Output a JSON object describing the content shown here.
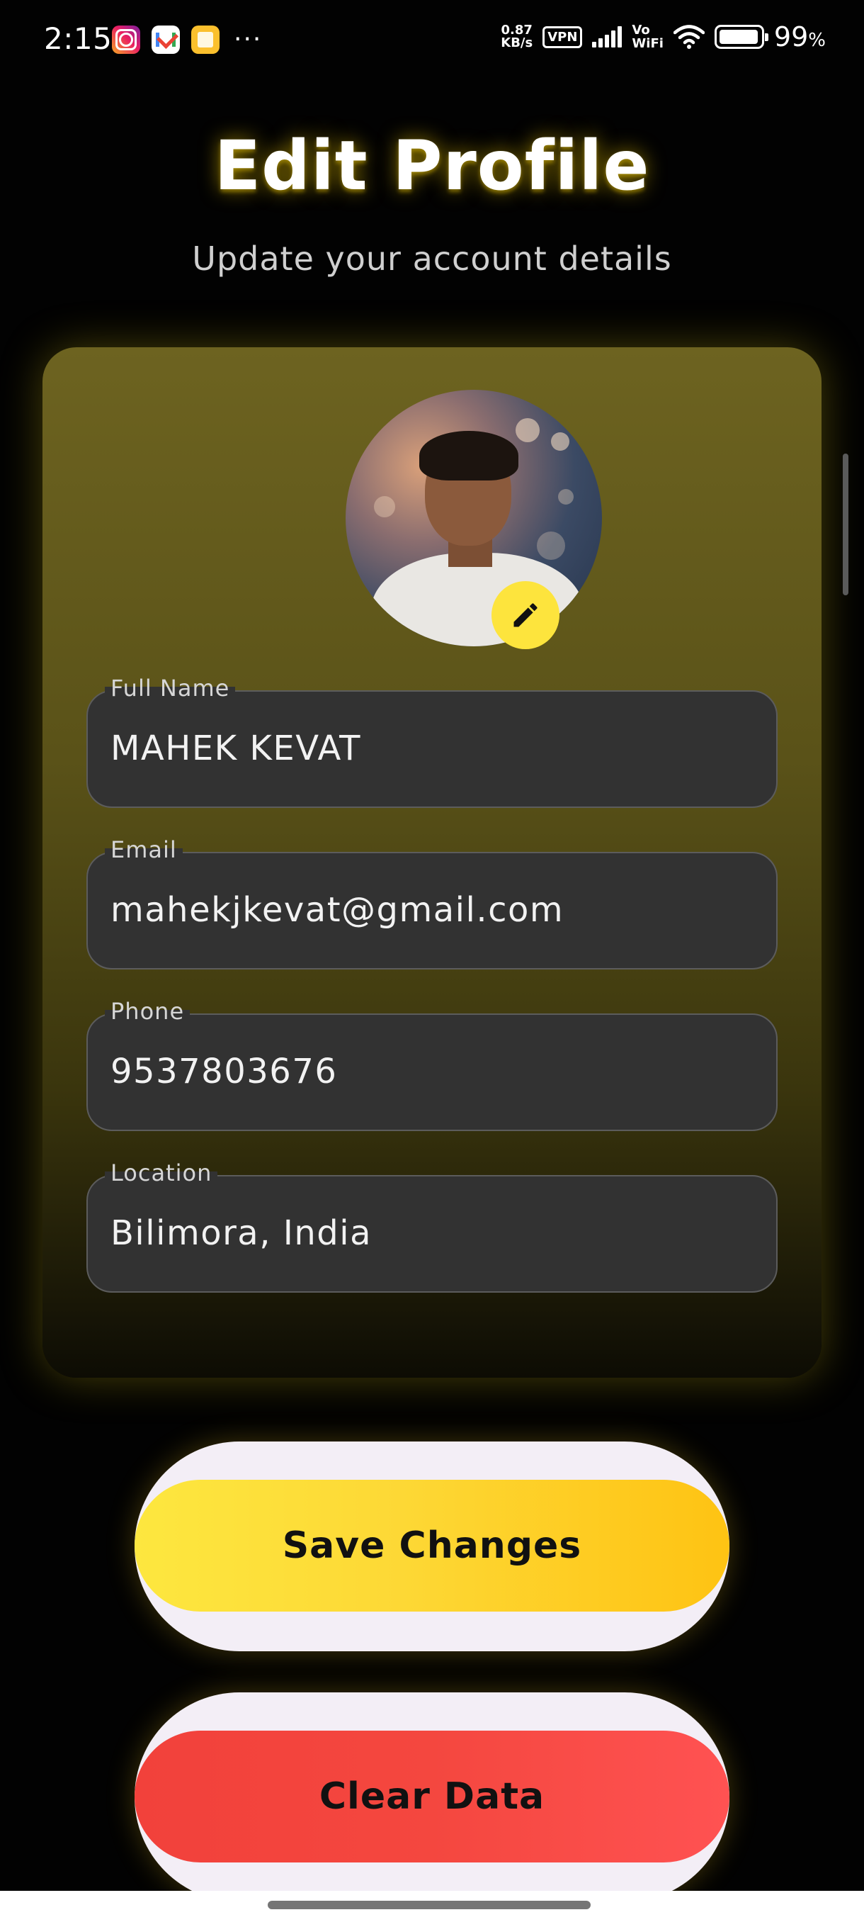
{
  "status_bar": {
    "time": "2:15",
    "apps": [
      "instagram-icon",
      "gmail-icon",
      "notes-icon"
    ],
    "more": "···",
    "speed_value": "0.87",
    "speed_unit": "KB/s",
    "vpn": "VPN",
    "vo": "Vo",
    "wifi_label": "WiFi",
    "battery_pct": "99",
    "battery_unit": "%"
  },
  "header": {
    "title": "Edit Profile",
    "subtitle": "Update your account details"
  },
  "fields": [
    {
      "label": "Full Name",
      "value": "MAHEK KEVAT"
    },
    {
      "label": "Email",
      "value": "mahekjkevat@gmail.com"
    },
    {
      "label": "Phone",
      "value": "9537803676"
    },
    {
      "label": "Location",
      "value": "Bilimora, India"
    }
  ],
  "buttons": {
    "save": "Save Changes",
    "clear": "Clear Data"
  },
  "colors": {
    "accent_yellow": "#fdd835",
    "danger_red": "#f44336",
    "card_olive": "#6d6320",
    "field_bg": "#323232"
  }
}
